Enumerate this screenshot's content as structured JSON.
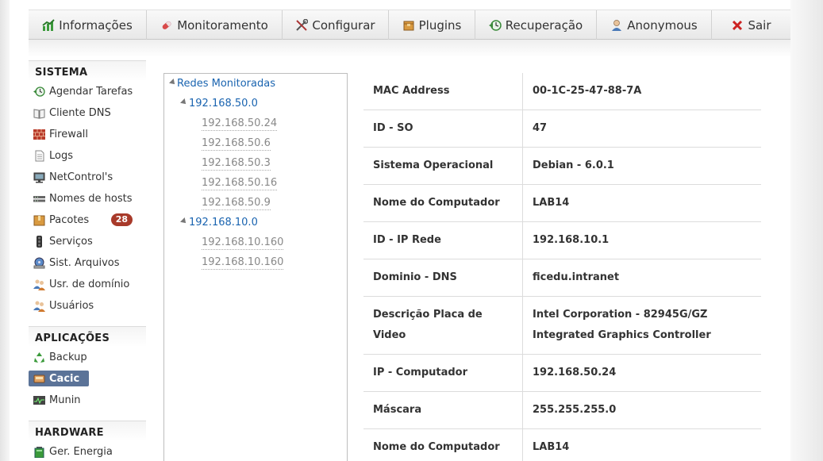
{
  "topmenu": [
    {
      "label": "Informações",
      "icon": "chart-icon"
    },
    {
      "label": "Monitoramento",
      "icon": "pill-icon"
    },
    {
      "label": "Configurar",
      "icon": "tools-icon"
    },
    {
      "label": "Plugins",
      "icon": "box-icon"
    },
    {
      "label": "Recuperação",
      "icon": "restore-icon"
    },
    {
      "label": "Anonymous",
      "icon": "user-icon"
    },
    {
      "label": "Sair",
      "icon": "close-icon"
    }
  ],
  "sidebar": {
    "sistema_title": "SISTEMA",
    "sistema": [
      {
        "label": "Agendar Tarefas",
        "icon": "clock-arrow-icon"
      },
      {
        "label": "Cliente DNS",
        "icon": "book-icon"
      },
      {
        "label": "Firewall",
        "icon": "brick-wall-icon"
      },
      {
        "label": "Logs",
        "icon": "document-icon"
      },
      {
        "label": "NetControl's",
        "icon": "computer-icon"
      },
      {
        "label": "Nomes de hosts",
        "icon": "server-icon"
      },
      {
        "label": "Pacotes",
        "icon": "package-icon",
        "badge": "28"
      },
      {
        "label": "Serviços",
        "icon": "traffic-light-icon"
      },
      {
        "label": "Sist. Arquivos",
        "icon": "drive-icon"
      },
      {
        "label": "Usr. de domínio",
        "icon": "users-icon"
      },
      {
        "label": "Usuários",
        "icon": "users-icon"
      }
    ],
    "aplicacoes_title": "APLICAÇÕES",
    "aplicacoes": [
      {
        "label": "Backup",
        "icon": "recycle-icon"
      },
      {
        "label": "Cacic",
        "icon": "cacic-icon",
        "active": true
      },
      {
        "label": "Munin",
        "icon": "monitor-graph-icon"
      }
    ],
    "hardware_title": "HARDWARE",
    "hardware": [
      {
        "label": "Ger. Energia",
        "icon": "battery-icon"
      }
    ]
  },
  "tree": {
    "root": "Redes Monitoradas",
    "networks": [
      {
        "name": "192.168.50.0",
        "hosts": [
          "192.168.50.24",
          "192.168.50.6",
          "192.168.50.3",
          "192.168.50.16",
          "192.168.50.9"
        ]
      },
      {
        "name": "192.168.10.0",
        "hosts": [
          "192.168.10.160",
          "192.168.10.160"
        ]
      }
    ]
  },
  "details": [
    {
      "label": "MAC Address",
      "value": "00-1C-25-47-88-7A"
    },
    {
      "label": "ID - SO",
      "value": "47"
    },
    {
      "label": "Sistema Operacional",
      "value": "Debian - 6.0.1"
    },
    {
      "label": "Nome do Computador",
      "value": "LAB14"
    },
    {
      "label": "ID - IP Rede",
      "value": "192.168.10.1"
    },
    {
      "label": "Dominio - DNS",
      "value": "ficedu.intranet"
    },
    {
      "label": "Descrição Placa de Video",
      "value": "Intel Corporation - 82945G/GZ Integrated Graphics Controller"
    },
    {
      "label": "IP - Computador",
      "value": "192.168.50.24"
    },
    {
      "label": "Máscara",
      "value": "255.255.255.0"
    },
    {
      "label": "Nome do Computador",
      "value": "LAB14"
    }
  ]
}
